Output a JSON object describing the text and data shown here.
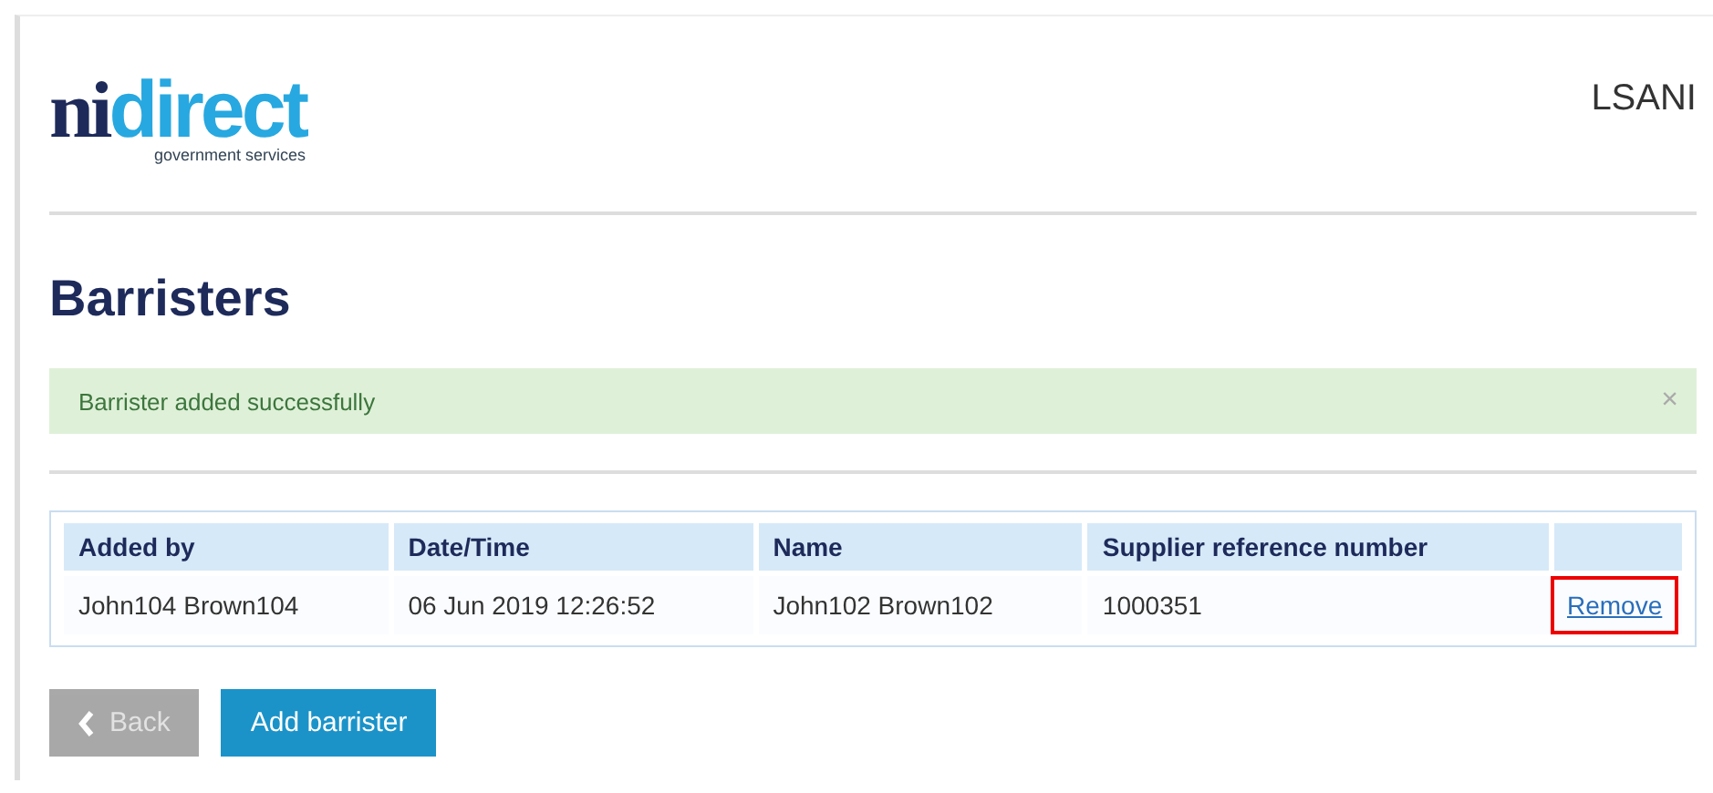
{
  "header": {
    "logo": {
      "primary": "ni",
      "secondary": "direct",
      "tagline": "government services"
    },
    "service_name": "LSANI"
  },
  "heading": "Barristers",
  "alert": {
    "message": "Barrister added successfully",
    "close": "×"
  },
  "table": {
    "columns": [
      "Added by",
      "Date/Time",
      "Name",
      "Supplier reference number",
      ""
    ],
    "rows": [
      {
        "cells": [
          "John104 Brown104",
          "06 Jun 2019 12:26:52",
          "John102 Brown102",
          "1000351"
        ],
        "action": {
          "label": "Remove",
          "highlighted": true
        }
      }
    ]
  },
  "buttons": [
    {
      "kind": "back",
      "label": "Back",
      "disabled": true
    },
    {
      "kind": "primary",
      "label": "Add barrister",
      "disabled": false
    }
  ]
}
